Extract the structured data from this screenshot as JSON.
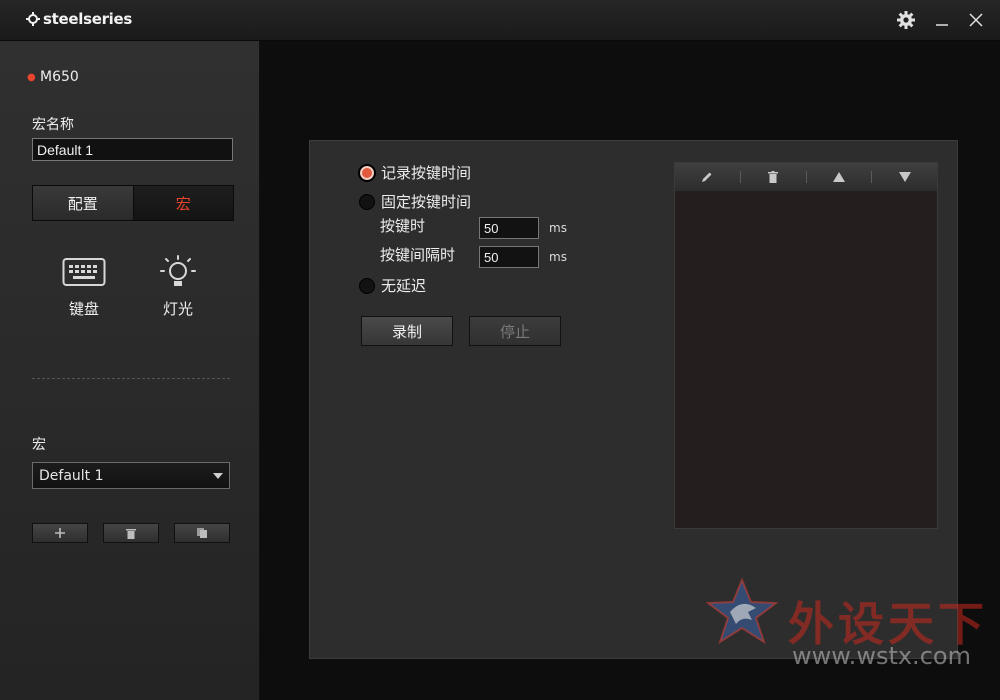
{
  "titlebar": {
    "brand": "steelseries"
  },
  "sidebar": {
    "device": "M650",
    "macro_name_label": "宏名称",
    "macro_name_value": "Default 1",
    "tabs": [
      {
        "label": "配置"
      },
      {
        "label": "宏"
      }
    ],
    "nav": [
      {
        "label": "键盘",
        "icon": "keyboard-icon"
      },
      {
        "label": "灯光",
        "icon": "light-bulb-icon"
      }
    ],
    "macro_section_label": "宏",
    "macro_select_value": "Default 1"
  },
  "main": {
    "record_timing_label": "记录按键时间",
    "fixed_timing_label": "固定按键时间",
    "press_time_label": "按键时",
    "press_time_value": "50",
    "interval_label": "按键间隔时",
    "interval_value": "50",
    "unit": "ms",
    "no_delay_label": "无延迟",
    "record_button": "录制",
    "stop_button": "停止"
  },
  "watermark": {
    "text": "外设天下",
    "url": "www.wstx.com"
  },
  "colors": {
    "accent": "#e8452c",
    "panel": "#2d2d2d",
    "sidebar": "#2a2a2a"
  }
}
